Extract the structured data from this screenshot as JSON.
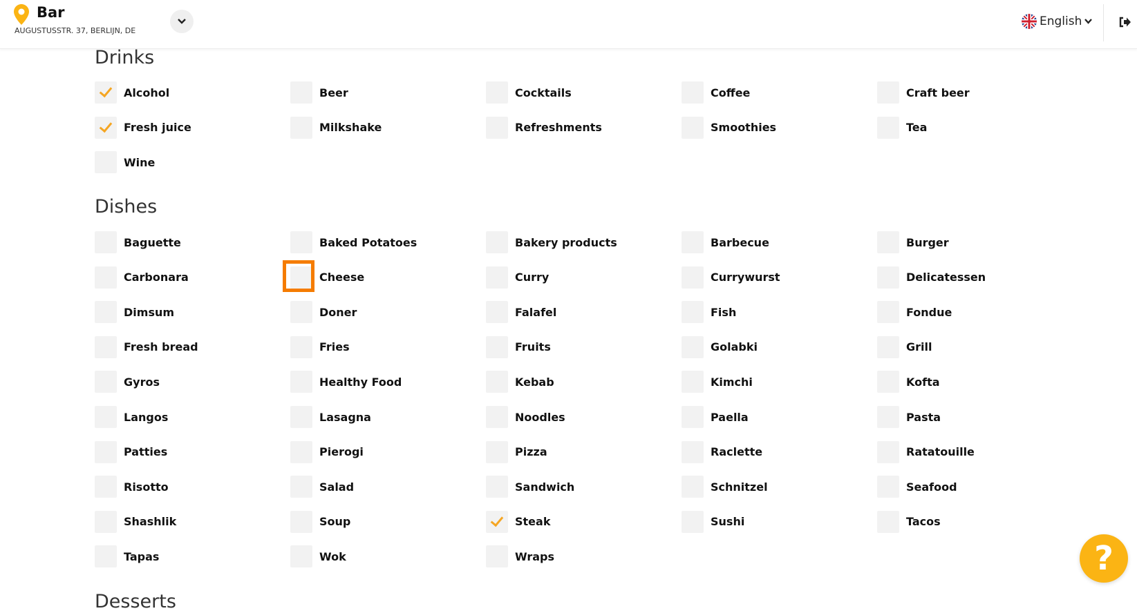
{
  "header": {
    "venue_name": "Bar",
    "venue_address": "AUGUSTUSSTR. 37, BERLIJN, DE",
    "language": "English",
    "accent_color": "#fbb414"
  },
  "sections": [
    {
      "title": "Drinks",
      "items": [
        {
          "label": "Alcohol",
          "checked": true
        },
        {
          "label": "Beer",
          "checked": false
        },
        {
          "label": "Cocktails",
          "checked": false
        },
        {
          "label": "Coffee",
          "checked": false
        },
        {
          "label": "Craft beer",
          "checked": false
        },
        {
          "label": "Fresh juice",
          "checked": true
        },
        {
          "label": "Milkshake",
          "checked": false
        },
        {
          "label": "Refreshments",
          "checked": false
        },
        {
          "label": "Smoothies",
          "checked": false
        },
        {
          "label": "Tea",
          "checked": false
        },
        {
          "label": "Wine",
          "checked": false
        }
      ]
    },
    {
      "title": "Dishes",
      "items": [
        {
          "label": "Baguette",
          "checked": false
        },
        {
          "label": "Baked Potatoes",
          "checked": false
        },
        {
          "label": "Bakery products",
          "checked": false
        },
        {
          "label": "Barbecue",
          "checked": false
        },
        {
          "label": "Burger",
          "checked": false
        },
        {
          "label": "Carbonara",
          "checked": false
        },
        {
          "label": "Cheese",
          "checked": false
        },
        {
          "label": "Curry",
          "checked": false
        },
        {
          "label": "Currywurst",
          "checked": false
        },
        {
          "label": "Delicatessen",
          "checked": false
        },
        {
          "label": "Dimsum",
          "checked": false
        },
        {
          "label": "Doner",
          "checked": false
        },
        {
          "label": "Falafel",
          "checked": false
        },
        {
          "label": "Fish",
          "checked": false
        },
        {
          "label": "Fondue",
          "checked": false
        },
        {
          "label": "Fresh bread",
          "checked": false
        },
        {
          "label": "Fries",
          "checked": false
        },
        {
          "label": "Fruits",
          "checked": false
        },
        {
          "label": "Golabki",
          "checked": false
        },
        {
          "label": "Grill",
          "checked": false
        },
        {
          "label": "Gyros",
          "checked": false
        },
        {
          "label": "Healthy Food",
          "checked": false
        },
        {
          "label": "Kebab",
          "checked": false
        },
        {
          "label": "Kimchi",
          "checked": false
        },
        {
          "label": "Kofta",
          "checked": false
        },
        {
          "label": "Langos",
          "checked": false
        },
        {
          "label": "Lasagna",
          "checked": false
        },
        {
          "label": "Noodles",
          "checked": false
        },
        {
          "label": "Paella",
          "checked": false
        },
        {
          "label": "Pasta",
          "checked": false
        },
        {
          "label": "Patties",
          "checked": false
        },
        {
          "label": "Pierogi",
          "checked": false
        },
        {
          "label": "Pizza",
          "checked": false
        },
        {
          "label": "Raclette",
          "checked": false
        },
        {
          "label": "Ratatouille",
          "checked": false
        },
        {
          "label": "Risotto",
          "checked": false
        },
        {
          "label": "Salad",
          "checked": false
        },
        {
          "label": "Sandwich",
          "checked": false
        },
        {
          "label": "Schnitzel",
          "checked": false
        },
        {
          "label": "Seafood",
          "checked": false
        },
        {
          "label": "Shashlik",
          "checked": false
        },
        {
          "label": "Soup",
          "checked": false
        },
        {
          "label": "Steak",
          "checked": true
        },
        {
          "label": "Sushi",
          "checked": false
        },
        {
          "label": "Tacos",
          "checked": false
        },
        {
          "label": "Tapas",
          "checked": false
        },
        {
          "label": "Wok",
          "checked": false
        },
        {
          "label": "Wraps",
          "checked": false
        }
      ]
    },
    {
      "title": "Desserts",
      "items": []
    }
  ],
  "help": {
    "glyph": "?"
  }
}
